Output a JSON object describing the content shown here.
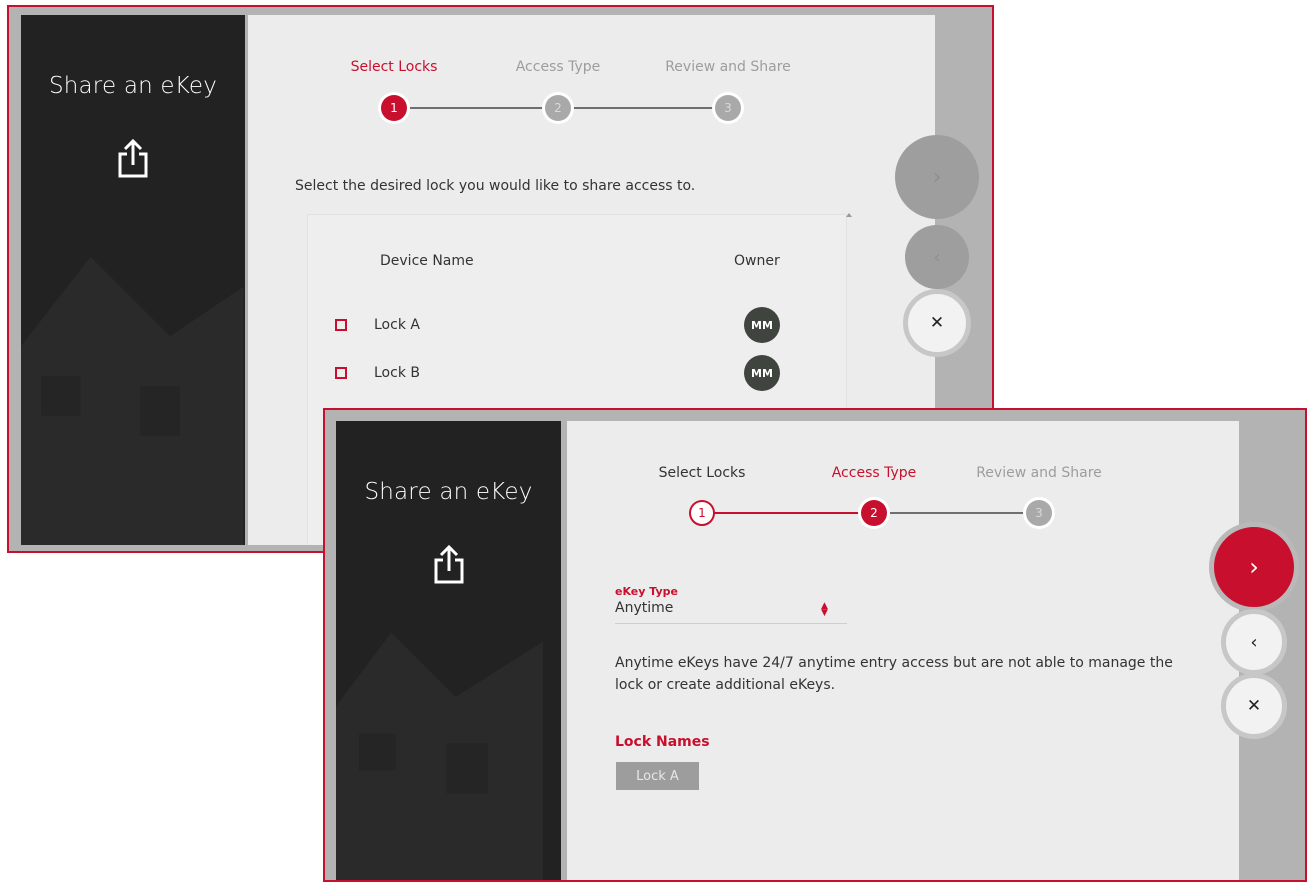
{
  "screen1": {
    "title": "Share an eKey",
    "steps": [
      {
        "number": "1",
        "label": "Select Locks",
        "state": "active"
      },
      {
        "number": "2",
        "label": "Access Type",
        "state": "pending"
      },
      {
        "number": "3",
        "label": "Review and Share",
        "state": "pending"
      }
    ],
    "instruction": "Select the desired lock you would like to share access to.",
    "table": {
      "headers": {
        "device": "Device Name",
        "owner": "Owner"
      },
      "rows": [
        {
          "name": "Lock A",
          "owner": "MM",
          "checked": false
        },
        {
          "name": "Lock B",
          "owner": "MM",
          "checked": false
        }
      ]
    },
    "actions": {
      "next": "›",
      "back": "‹",
      "close": "✕"
    }
  },
  "screen2": {
    "title": "Share an eKey",
    "steps": [
      {
        "number": "1",
        "label": "Select Locks",
        "state": "done"
      },
      {
        "number": "2",
        "label": "Access Type",
        "state": "active"
      },
      {
        "number": "3",
        "label": "Review and Share",
        "state": "pending"
      }
    ],
    "ekey_type": {
      "label": "eKey Type",
      "value": "Anytime"
    },
    "description_line1": "Anytime eKeys have 24/7 anytime entry access but are not able to manage the",
    "description_line2": "lock or create additional eKeys.",
    "lock_names": {
      "title": "Lock Names",
      "items": [
        "Lock A"
      ]
    },
    "actions": {
      "next": "›",
      "back": "‹",
      "close": "✕"
    }
  },
  "colors": {
    "accent": "#c8102e",
    "sidebar": "#222222",
    "panel": "#ececec",
    "owner_badge": "#3f443f"
  },
  "icons": {
    "share": "share-icon",
    "checkbox": "checkbox-icon",
    "select_arrows": "sort-arrows-icon"
  }
}
